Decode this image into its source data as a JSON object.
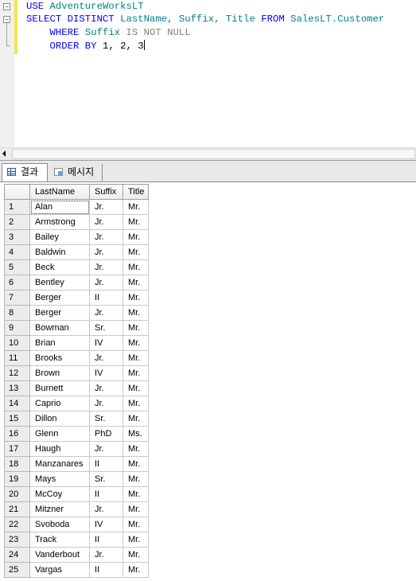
{
  "editor": {
    "lines": {
      "l1": {
        "kw1": "USE",
        "obj": "AdventureWorksLT"
      },
      "l2": {
        "kw1": "SELECT DISTINCT",
        "cols": "LastName, Suffix, Title",
        "kw2": "FROM",
        "table": "SalesLT.Customer"
      },
      "l3": {
        "kw1": "WHERE",
        "col": "Suffix",
        "rest": "IS NOT NULL"
      },
      "l4": {
        "kw1": "ORDER BY",
        "rest": "1, 2, 3"
      }
    }
  },
  "tabs": {
    "results": "결과",
    "messages": "메시지"
  },
  "grid": {
    "columns": [
      "",
      "LastName",
      "Suffix",
      "Title"
    ],
    "rows": [
      [
        "1",
        "Alan",
        "Jr.",
        "Mr."
      ],
      [
        "2",
        "Armstrong",
        "Jr.",
        "Mr."
      ],
      [
        "3",
        "Bailey",
        "Jr.",
        "Mr."
      ],
      [
        "4",
        "Baldwin",
        "Jr.",
        "Mr."
      ],
      [
        "5",
        "Beck",
        "Jr.",
        "Mr."
      ],
      [
        "6",
        "Bentley",
        "Jr.",
        "Mr."
      ],
      [
        "7",
        "Berger",
        "II",
        "Mr."
      ],
      [
        "8",
        "Berger",
        "Jr.",
        "Mr."
      ],
      [
        "9",
        "Bowman",
        "Sr.",
        "Mr."
      ],
      [
        "10",
        "Brian",
        "IV",
        "Mr."
      ],
      [
        "11",
        "Brooks",
        "Jr.",
        "Mr."
      ],
      [
        "12",
        "Brown",
        "IV",
        "Mr."
      ],
      [
        "13",
        "Burnett",
        "Jr.",
        "Mr."
      ],
      [
        "14",
        "Caprio",
        "Jr.",
        "Mr."
      ],
      [
        "15",
        "Dillon",
        "Sr.",
        "Mr."
      ],
      [
        "16",
        "Glenn",
        "PhD",
        "Ms."
      ],
      [
        "17",
        "Haugh",
        "Jr.",
        "Mr."
      ],
      [
        "18",
        "Manzanares",
        "II",
        "Mr."
      ],
      [
        "19",
        "Mays",
        "Sr.",
        "Mr."
      ],
      [
        "20",
        "McCoy",
        "II",
        "Mr."
      ],
      [
        "21",
        "Mitzner",
        "Jr.",
        "Mr."
      ],
      [
        "22",
        "Svoboda",
        "IV",
        "Mr."
      ],
      [
        "23",
        "Track",
        "II",
        "Mr."
      ],
      [
        "24",
        "Vanderbout",
        "Jr.",
        "Mr."
      ],
      [
        "25",
        "Vargas",
        "II",
        "Mr."
      ]
    ]
  }
}
